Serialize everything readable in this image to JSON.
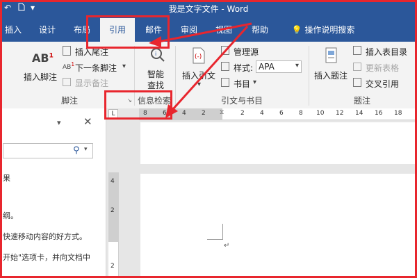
{
  "window": {
    "title": "我是文字文件 - Word",
    "autosave_icon": "undo-icon",
    "customize_icon": "dropdown-icon"
  },
  "tabs": [
    {
      "label": "插入"
    },
    {
      "label": "设计"
    },
    {
      "label": "布局"
    },
    {
      "label": "引用",
      "active": true
    },
    {
      "label": "邮件"
    },
    {
      "label": "审阅"
    },
    {
      "label": "视图"
    },
    {
      "label": "帮助"
    }
  ],
  "tell_me": {
    "label": "操作说明搜索",
    "icon": "lightbulb-icon"
  },
  "ribbon": {
    "footnotes": {
      "ab1": "AB",
      "ab_sup": "1",
      "insert_footnote": "插入脚注",
      "insert_endnote": "插入尾注",
      "next_footnote": "下一条脚注",
      "show_notes": "显示备注",
      "group": "脚注"
    },
    "research": {
      "smart_lookup_1": "智能",
      "smart_lookup_2": "查找",
      "group": "信息检索"
    },
    "citations": {
      "insert_citation": "插入引文",
      "manage_sources": "管理源",
      "style_label": "样式:",
      "style_value": "APA",
      "bibliography": "书目",
      "group": "引文与书目"
    },
    "captions": {
      "insert_caption": "插入题注",
      "insert_table_of_figures": "插入表目录",
      "update_table": "更新表格",
      "cross_reference": "交叉引用",
      "group": "题注"
    }
  },
  "nav_pane": {
    "search_icon": "search-icon",
    "lines": [
      "果",
      "纲。",
      "快速移动内容的好方式。",
      "开始\"选项卡，并向文档中"
    ]
  },
  "ruler": {
    "h_numbers": [
      "8",
      "6",
      "4",
      "2",
      "2",
      "4",
      "6",
      "8",
      "10",
      "12",
      "14",
      "16",
      "18"
    ],
    "v_numbers": [
      "4",
      "2",
      "2"
    ]
  },
  "document": {
    "para_mark": "↵"
  },
  "colors": {
    "word_blue": "#2b579a",
    "annotation_red": "#e8262e"
  }
}
